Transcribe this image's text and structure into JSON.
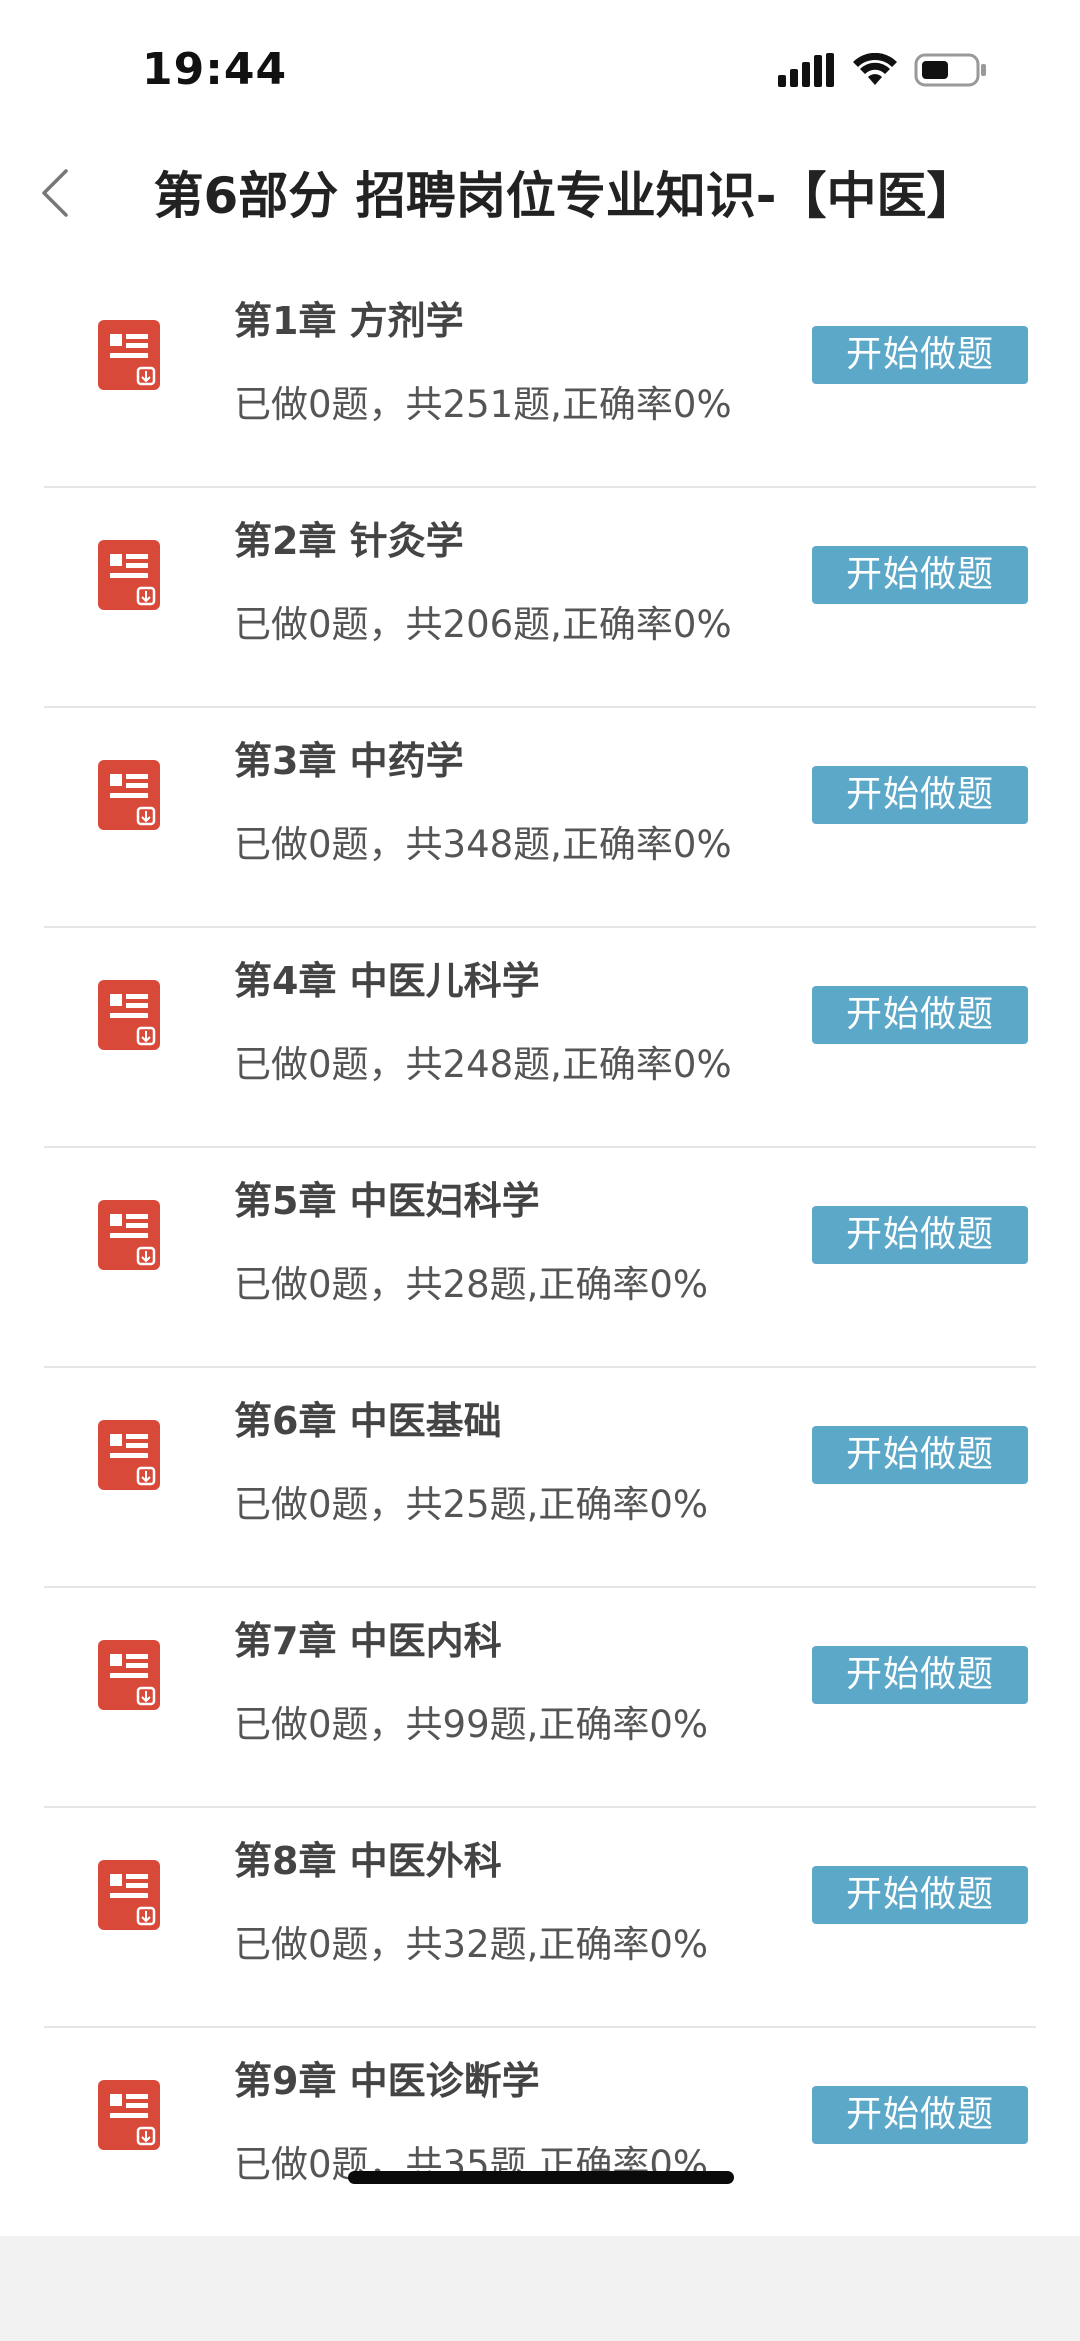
{
  "status_bar": {
    "time": "19:44",
    "icons": [
      "cellular-signal-icon",
      "wifi-icon",
      "battery-icon"
    ]
  },
  "header": {
    "title": "第6部分 招聘岗位专业知识-【中医】",
    "back_icon": "chevron-left-icon"
  },
  "chapters": [
    {
      "title": "第1章 方剂学",
      "stats": "已做0题，共251题,正确率0%",
      "button": "开始做题"
    },
    {
      "title": "第2章 针灸学",
      "stats": "已做0题，共206题,正确率0%",
      "button": "开始做题"
    },
    {
      "title": "第3章 中药学",
      "stats": "已做0题，共348题,正确率0%",
      "button": "开始做题"
    },
    {
      "title": "第4章 中医儿科学",
      "stats": "已做0题，共248题,正确率0%",
      "button": "开始做题"
    },
    {
      "title": "第5章 中医妇科学",
      "stats": "已做0题，共28题,正确率0%",
      "button": "开始做题"
    },
    {
      "title": "第6章 中医基础",
      "stats": "已做0题，共25题,正确率0%",
      "button": "开始做题"
    },
    {
      "title": "第7章 中医内科",
      "stats": "已做0题，共99题,正确率0%",
      "button": "开始做题"
    },
    {
      "title": "第8章 中医外科",
      "stats": "已做0题，共32题,正确率0%",
      "button": "开始做题"
    },
    {
      "title": "第9章 中医诊断学",
      "stats": "已做0题，共35题,正确率0%",
      "button": "开始做题"
    }
  ],
  "colors": {
    "button_bg": "#5ba8c9",
    "icon_red": "#d9493a",
    "divider": "#e6e6e6"
  }
}
